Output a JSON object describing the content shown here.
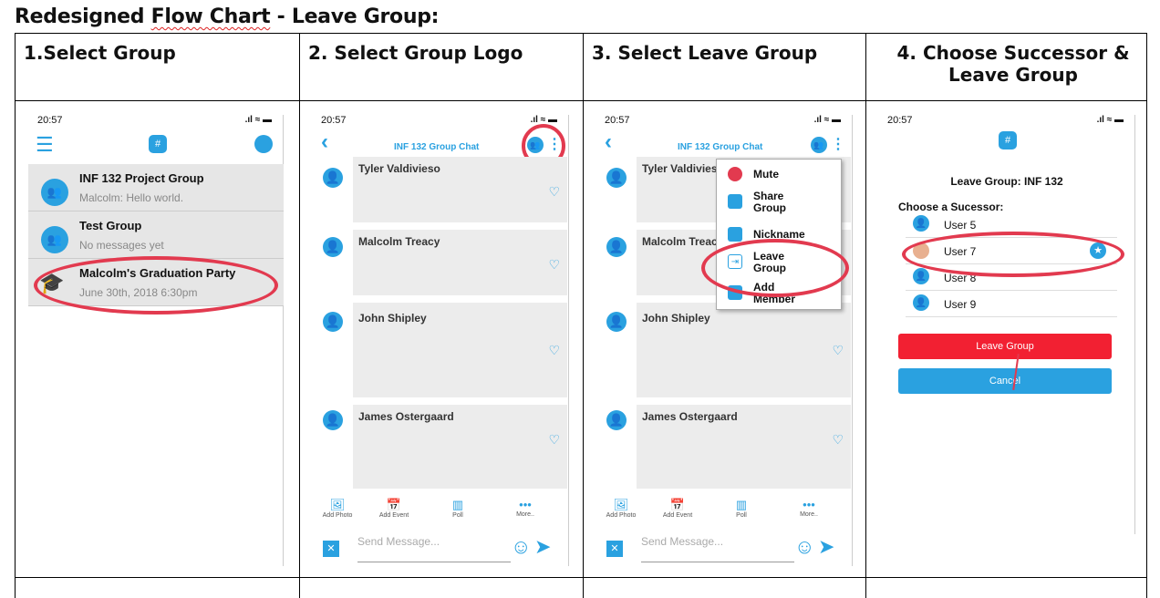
{
  "doc": {
    "title_a": "Redesigned ",
    "title_b": "Flow Chart",
    "title_c": " - Leave Group:"
  },
  "headers": [
    "1.Select Group",
    "2. Select Group Logo",
    "3. Select Leave Group",
    "4. Choose Successor & Leave Group"
  ],
  "status": {
    "time": "20:57",
    "icons": ".ıl ≈ ▬"
  },
  "screen1": {
    "groups": [
      {
        "title": "INF 132 Project Group",
        "sub": "Malcolm: Hello world."
      },
      {
        "title": "Test Group",
        "sub": "No messages yet"
      },
      {
        "title": "Malcolm's Graduation Party",
        "sub": "June 30th, 2018 6:30pm"
      }
    ]
  },
  "chat": {
    "title": "INF 132 Group Chat",
    "back": "‹",
    "kebab": "⋮",
    "people": [
      "Tyler Valdivieso",
      "Malcolm Treacy",
      "John Shipley",
      "James Ostergaard"
    ],
    "toolbar": [
      "Add Photo",
      "Add Event",
      "Poll",
      "More.."
    ],
    "placeholder": "Send Message...",
    "close": "✕",
    "emoji": "☺",
    "send": "➤"
  },
  "menu": {
    "items": [
      "Mute",
      "Share Group",
      "Nickname",
      "Leave Group",
      "Add Member"
    ]
  },
  "screen4": {
    "heading": "Leave Group: INF 132",
    "choose": "Choose a Sucessor:",
    "users": [
      "User 5",
      "User 7",
      "User 8",
      "User 9"
    ],
    "leave": "Leave Group",
    "cancel": "Cancel"
  },
  "colors": {
    "accent": "#2aa1e0",
    "danger": "#f22032",
    "circle": "#e23a4f"
  }
}
